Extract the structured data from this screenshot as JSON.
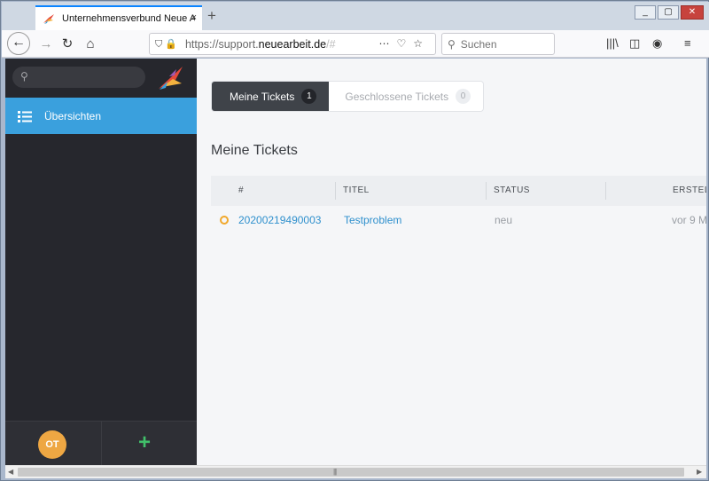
{
  "browser": {
    "tab_title": "Unternehmensverbund Neue A",
    "tab_close": "×",
    "new_tab": "+",
    "window_buttons": [
      "_",
      "▢",
      "✕"
    ],
    "url_prefix": "https://support.",
    "url_domain": "neuearbeit.de",
    "url_suffix": "/#",
    "search_placeholder": "Suchen",
    "toolbar_icons": [
      "library-icon",
      "sidebar-icon",
      "account-icon",
      "menu-icon"
    ]
  },
  "sidebar": {
    "nav_label": "Übersichten",
    "user_initials": "OT",
    "add_label": "+"
  },
  "tabs": [
    {
      "label": "Meine Tickets",
      "count": "1"
    },
    {
      "label": "Geschlossene Tickets",
      "count": "0"
    }
  ],
  "heading": "Meine Tickets",
  "table": {
    "columns": [
      "#",
      "TITEL",
      "STATUS",
      "ERSTEL"
    ],
    "rows": [
      {
        "number": "20200219490003",
        "title": "Testproblem",
        "status": "neu",
        "created": "vor 9 M"
      }
    ]
  },
  "colors": {
    "accent": "#3aa0dd",
    "sidebar": "#26272d",
    "status_open": "#f1a82b",
    "add": "#41c06a"
  }
}
